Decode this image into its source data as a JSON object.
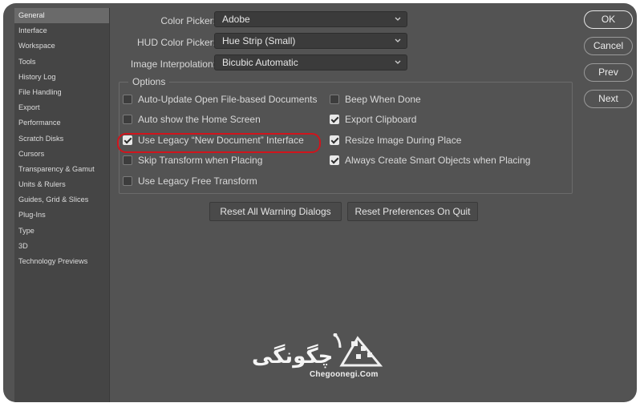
{
  "sidebar": {
    "items": [
      {
        "label": "General",
        "selected": true
      },
      {
        "label": "Interface"
      },
      {
        "label": "Workspace"
      },
      {
        "label": "Tools"
      },
      {
        "label": "History Log"
      },
      {
        "label": "File Handling"
      },
      {
        "label": "Export"
      },
      {
        "label": "Performance"
      },
      {
        "label": "Scratch Disks"
      },
      {
        "label": "Cursors"
      },
      {
        "label": "Transparency & Gamut"
      },
      {
        "label": "Units & Rulers"
      },
      {
        "label": "Guides, Grid & Slices"
      },
      {
        "label": "Plug-Ins"
      },
      {
        "label": "Type"
      },
      {
        "label": "3D"
      },
      {
        "label": "Technology Previews"
      }
    ]
  },
  "settings": {
    "color_picker": {
      "label": "Color Picker:",
      "value": "Adobe"
    },
    "hud_color_picker": {
      "label": "HUD Color Picker:",
      "value": "Hue Strip (Small)"
    },
    "image_interpolation": {
      "label": "Image Interpolation:",
      "value": "Bicubic Automatic"
    }
  },
  "options": {
    "title": "Options",
    "left": [
      {
        "label": "Auto-Update Open File-based Documents",
        "checked": false
      },
      {
        "label": "Auto show the Home Screen",
        "checked": false
      },
      {
        "label": "Use Legacy “New Document” Interface",
        "checked": true
      },
      {
        "label": "Skip Transform when Placing",
        "checked": false
      },
      {
        "label": "Use Legacy Free Transform",
        "checked": false
      }
    ],
    "right": [
      {
        "label": "Beep When Done",
        "checked": false
      },
      {
        "label": "Export Clipboard",
        "checked": true
      },
      {
        "label": "Resize Image During Place",
        "checked": true
      },
      {
        "label": "Always Create Smart Objects when Placing",
        "checked": true
      }
    ]
  },
  "actions": {
    "reset_warnings": "Reset All Warning Dialogs",
    "reset_preferences": "Reset Preferences On Quit"
  },
  "dialog_buttons": {
    "ok": "OK",
    "cancel": "Cancel",
    "prev": "Prev",
    "next": "Next"
  },
  "watermark": {
    "brand": "چگونگی",
    "url": "Chegoonegi.Com"
  },
  "colors": {
    "background": "#535353",
    "sidebar": "#454545",
    "highlight": "#d0141c"
  }
}
